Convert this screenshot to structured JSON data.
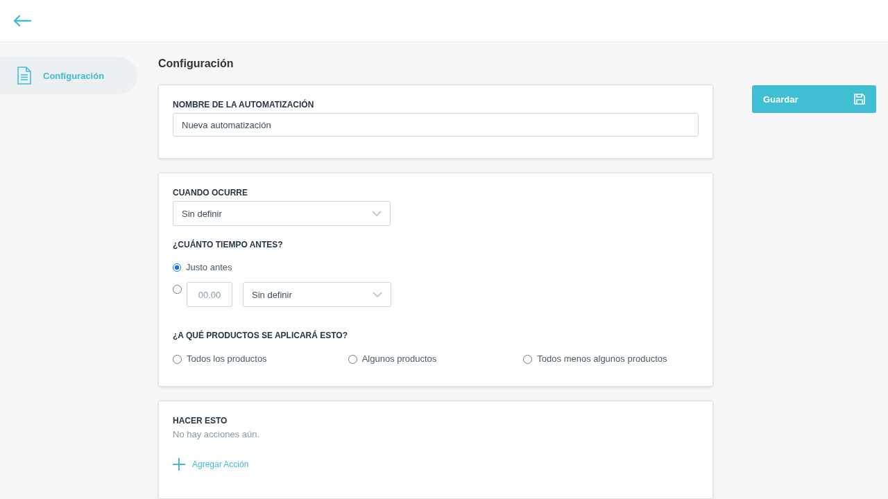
{
  "sidebar": {
    "items": [
      {
        "label": "Configuración",
        "selected": true
      }
    ]
  },
  "page_title": "Configuración",
  "name_card": {
    "label": "NOMBRE DE LA AUTOMATIZACIÓN",
    "value": "Nueva automatización"
  },
  "trigger_card": {
    "trigger": {
      "label": "CUANDO OCURRE",
      "value": "Sin definir"
    },
    "timing": {
      "label": "¿CUÁNTO TIEMPO ANTES?",
      "options": [
        {
          "kind": "plain",
          "label": "Justo antes",
          "selected": true
        },
        {
          "kind": "amount",
          "placeholder": "00.00",
          "unit": "Sin definir",
          "selected": false
        }
      ]
    },
    "products": {
      "label": "¿A QUÉ PRODUCTOS SE APLICARÁ ESTO?",
      "options": [
        {
          "label": "Todos los productos",
          "selected": false
        },
        {
          "label": "Algunos productos",
          "selected": false
        },
        {
          "label": "Todos menos algunos productos",
          "selected": false
        }
      ]
    }
  },
  "actions_card": {
    "label": "HACER ESTO",
    "empty_text": "No hay acciones aún.",
    "add_button": "Agregar Acción"
  },
  "save_button": "Guardar"
}
